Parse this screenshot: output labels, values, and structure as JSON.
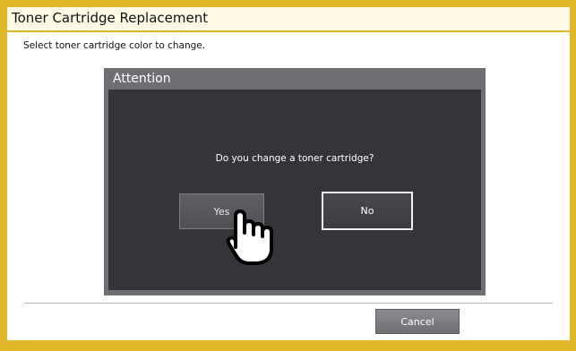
{
  "window": {
    "title": "Toner Cartridge Replacement",
    "instruction": "Select toner cartridge color to change."
  },
  "dialog": {
    "title": "Attention",
    "message": "Do you change a toner cartridge?",
    "yes_label": "Yes",
    "no_label": "No"
  },
  "footer": {
    "cancel_label": "Cancel"
  },
  "icons": {
    "pointer": "pointing-hand-icon"
  },
  "colors": {
    "frame": "#e2b82b",
    "dialog_header": "#6d6f73",
    "dialog_body": "#343539"
  }
}
